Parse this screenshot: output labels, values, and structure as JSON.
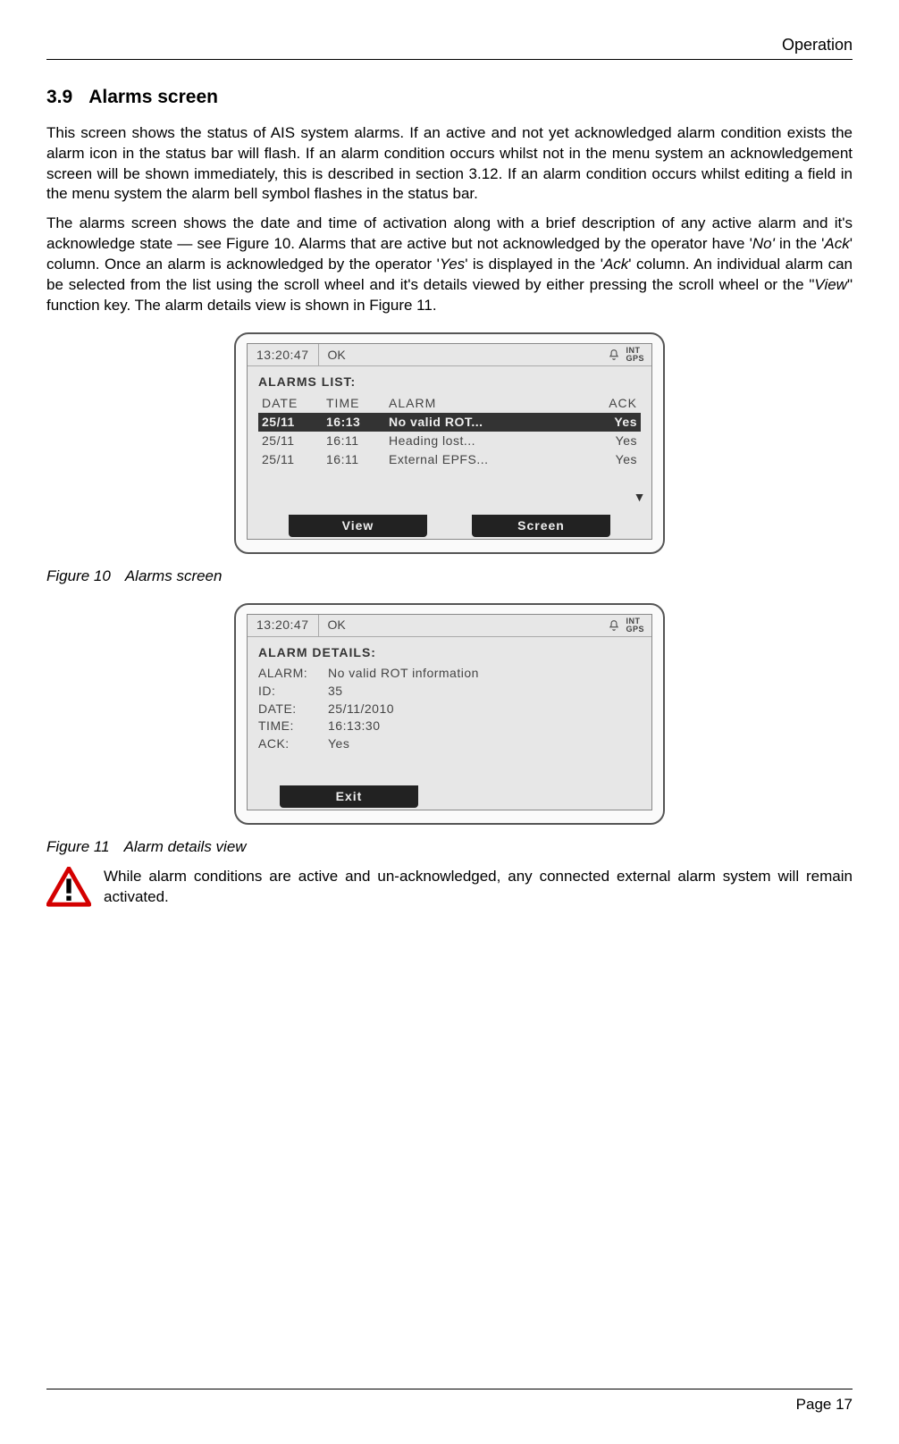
{
  "header": {
    "running_head": "Operation"
  },
  "section": {
    "number": "3.9",
    "title": "Alarms screen"
  },
  "paragraphs": {
    "p1": "This screen shows the status of AIS system alarms. If an active and not yet acknowledged alarm condition exists the alarm icon in the status bar will flash. If an alarm condition occurs whilst not in the menu system an acknowledgement screen will be shown immediately, this is described in section 3.12. If an alarm condition occurs whilst editing a field in the menu system the alarm bell symbol flashes in the status bar.",
    "p2a": "The alarms screen shows the date and time of activation along with a brief description of any active alarm and it's acknowledge state — see Figure 10. Alarms that are active but not acknowledged by the operator have '",
    "p2_no": "No'",
    "p2b": " in the '",
    "p2_ack1": "Ack",
    "p2c": "' column. Once an alarm is acknowledged by the operator '",
    "p2_yes": "Yes",
    "p2d": "' is displayed in the '",
    "p2_ack2": "Ack",
    "p2e": "' column. An individual alarm can be selected from the list using the scroll wheel and it's details viewed by either pressing the scroll wheel or the \"",
    "p2_view": "View",
    "p2f": "\" function key. The alarm details view is shown in Figure 11."
  },
  "fig10": {
    "status": {
      "time": "13:20:47",
      "ok": "OK",
      "int": "INT",
      "gps": "GPS"
    },
    "title": "ALARMS LIST:",
    "columns": {
      "date": "DATE",
      "time": "TIME",
      "alarm": "ALARM",
      "ack": "ACK"
    },
    "rows": [
      {
        "date": "25/11",
        "time": "16:13",
        "alarm": "No valid ROT...",
        "ack": "Yes",
        "selected": true
      },
      {
        "date": "25/11",
        "time": "16:11",
        "alarm": "Heading lost...",
        "ack": "Yes",
        "selected": false
      },
      {
        "date": "25/11",
        "time": "16:11",
        "alarm": "External EPFS...",
        "ack": "Yes",
        "selected": false
      }
    ],
    "softkeys": {
      "left": "View",
      "right": "Screen"
    },
    "caption_label": "Figure 10",
    "caption_text": "Alarms screen"
  },
  "fig11": {
    "status": {
      "time": "13:20:47",
      "ok": "OK",
      "int": "INT",
      "gps": "GPS"
    },
    "title": "ALARM DETAILS:",
    "labels": {
      "alarm": "ALARM:",
      "id": "ID:",
      "date": "DATE:",
      "time": "TIME:",
      "ack": "ACK:"
    },
    "values": {
      "alarm": "No valid ROT information",
      "id": "35",
      "date": "25/11/2010",
      "time": "16:13:30",
      "ack": "Yes"
    },
    "softkeys": {
      "left": "Exit"
    },
    "caption_label": "Figure 11",
    "caption_text": "Alarm details view"
  },
  "warning": {
    "text": "While alarm conditions are active and un-acknowledged, any connected external alarm system will remain activated."
  },
  "footer": {
    "page_label": "Page 17"
  }
}
